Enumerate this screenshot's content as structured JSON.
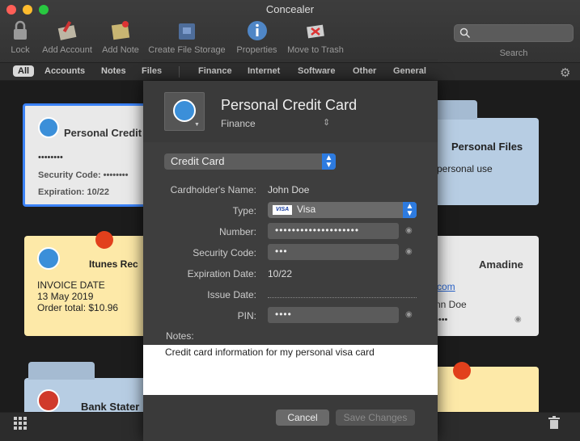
{
  "window": {
    "title": "Concealer"
  },
  "toolbar": {
    "lock": "Lock",
    "add_account": "Add Account",
    "add_note": "Add Note",
    "create_file_storage": "Create File Storage",
    "properties": "Properties",
    "move_to_trash": "Move to Trash",
    "search_label": "Search",
    "search_placeholder": ""
  },
  "tabs": {
    "all": "All",
    "accounts": "Accounts",
    "notes": "Notes",
    "files": "Files",
    "finance": "Finance",
    "internet": "Internet",
    "software": "Software",
    "other": "Other",
    "general": "General"
  },
  "cards": {
    "credit": {
      "title": "Personal Credit",
      "dots": "••••••••",
      "security_label": "Security Code: ••••••••",
      "expiration": "Expiration: 10/22"
    },
    "itunes": {
      "title": "Itunes Rec",
      "line1": "INVOICE DATE",
      "line2": "13 May 2019",
      "line3": "Order total: $10.96"
    },
    "bank": {
      "title": "Bank Stater"
    },
    "files": {
      "title": "Personal Files",
      "text": "personal use"
    },
    "amadine": {
      "title": "Amadine",
      "link": "com",
      "name": "nn Doe",
      "dots": "••••"
    }
  },
  "modal": {
    "title": "Personal Credit Card",
    "category": "Finance",
    "template": "Credit Card",
    "fields": {
      "cardholder_label": "Cardholder's Name:",
      "cardholder_value": "John Doe",
      "type_label": "Type:",
      "type_value": "Visa",
      "type_badge": "VISA",
      "number_label": "Number:",
      "number_value": "••••••••••••••••••••",
      "security_label": "Security Code:",
      "security_value": "•••",
      "expiration_label": "Expiration Date:",
      "expiration_value": "10/22",
      "issue_label": "Issue Date:",
      "pin_label": "PIN:",
      "pin_value": "••••"
    },
    "notes_label": "Notes:",
    "notes_text": "Credit card information for my personal visa card",
    "cancel": "Cancel",
    "save": "Save Changes"
  },
  "colors": {
    "accent": "#2d7be0",
    "card_selected_border": "#3b82f6",
    "note_yellow": "#fde9a8",
    "folder_blue": "#b7cde3"
  }
}
